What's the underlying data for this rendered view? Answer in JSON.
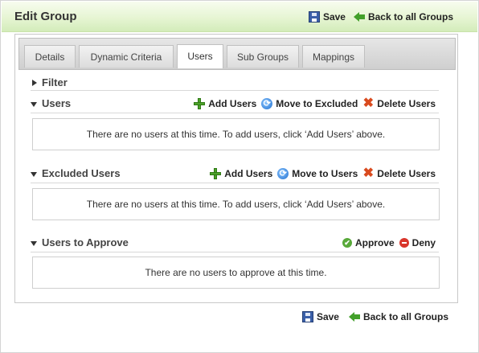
{
  "header": {
    "title": "Edit Group",
    "save_label": "Save",
    "back_label": "Back to all Groups"
  },
  "tabs": [
    {
      "label": "Details",
      "active": false
    },
    {
      "label": "Dynamic Criteria",
      "active": false
    },
    {
      "label": "Users",
      "active": true
    },
    {
      "label": "Sub Groups",
      "active": false
    },
    {
      "label": "Mappings",
      "active": false
    }
  ],
  "filter": {
    "title": "Filter",
    "icon": "triangle-right-icon"
  },
  "users": {
    "title": "Users",
    "actions": {
      "add": "Add Users",
      "move": "Move to Excluded",
      "delete": "Delete Users"
    },
    "empty_message": "There are no users at this time. To add users, click ‘Add Users’ above."
  },
  "excluded": {
    "title": "Excluded Users",
    "actions": {
      "add": "Add Users",
      "move": "Move to Users",
      "delete": "Delete Users"
    },
    "empty_message": "There are no users at this time. To add users, click ‘Add Users’ above."
  },
  "approve": {
    "title": "Users to Approve",
    "actions": {
      "approve": "Approve",
      "deny": "Deny"
    },
    "empty_message": "There are no users to approve at this time."
  },
  "footer": {
    "save_label": "Save",
    "back_label": "Back to all Groups"
  },
  "colors": {
    "header_green": "#e6f5d3",
    "add_icon": "#4ea22b",
    "delete_icon": "#d94a1e",
    "refresh_icon": "#1f6fcf",
    "deny_icon": "#d9352b",
    "approve_icon": "#58a93a"
  }
}
